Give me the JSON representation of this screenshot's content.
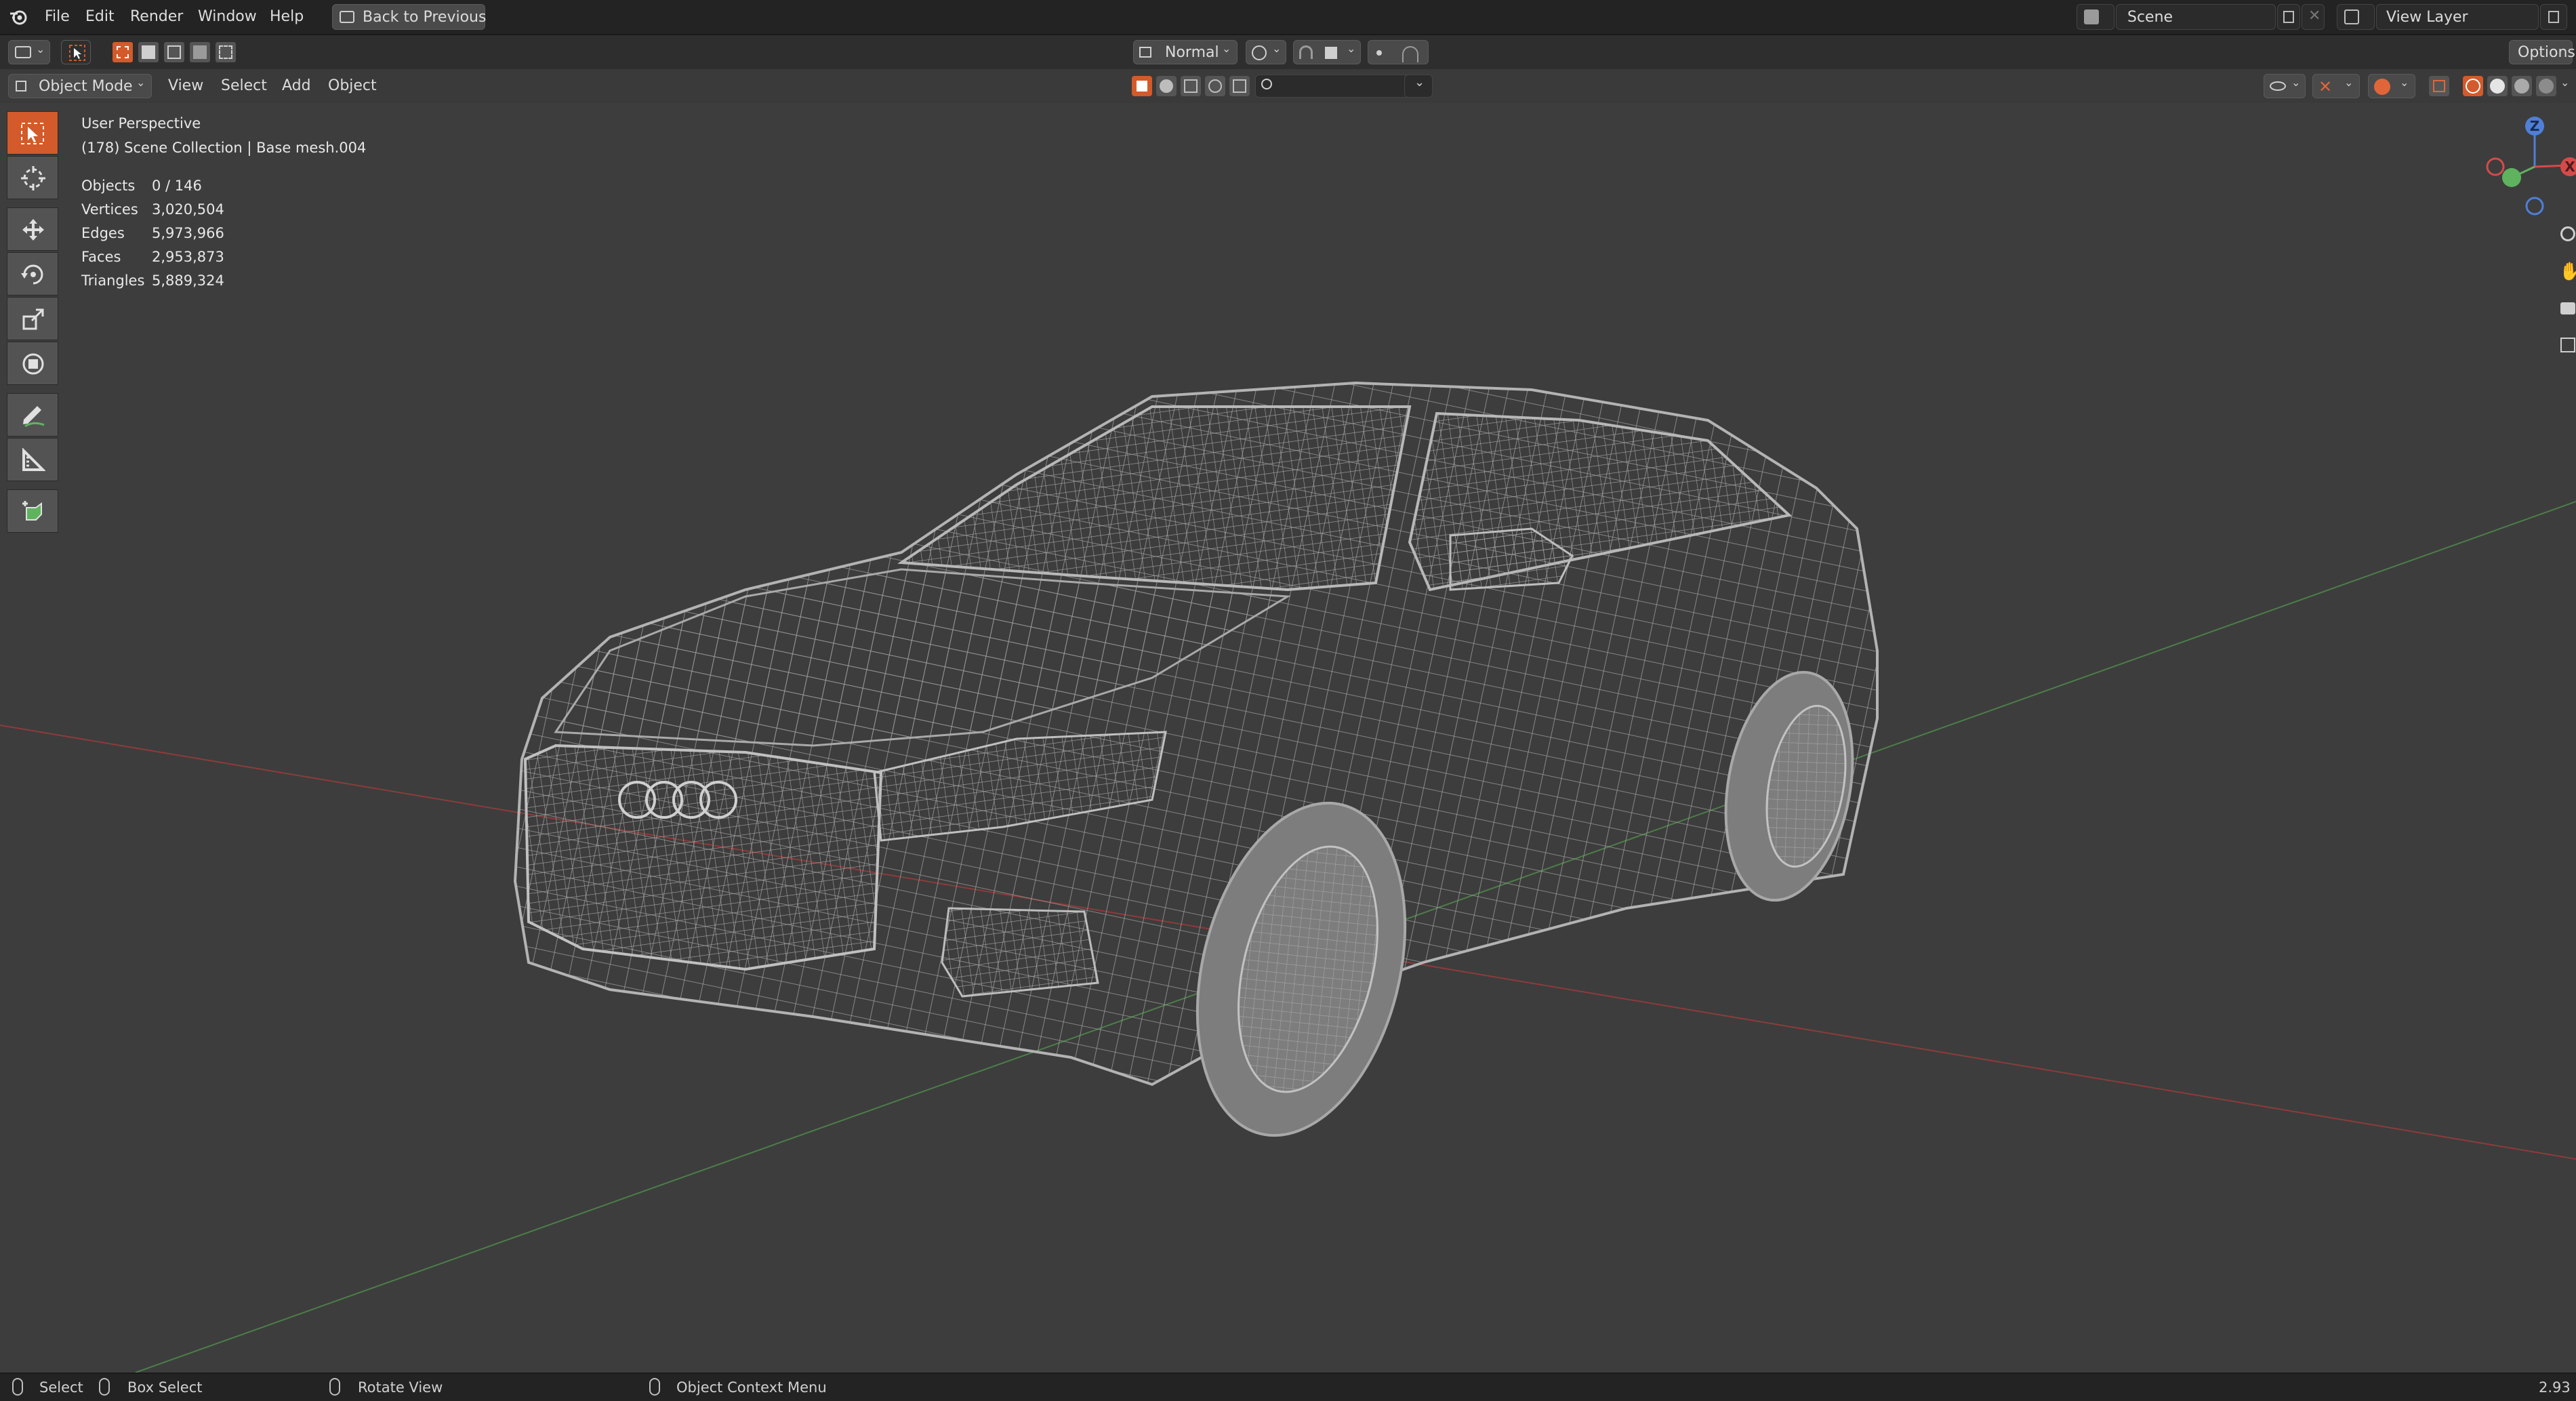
{
  "menubar": {
    "items": [
      "File",
      "Edit",
      "Render",
      "Window",
      "Help"
    ],
    "back_button": "Back to Previous",
    "scene_label": "Scene",
    "view_layer_label": "View Layer"
  },
  "toolheader": {
    "transform_orientation": "Normal",
    "options_label": "Options"
  },
  "viewheader": {
    "mode": "Object Mode",
    "menus": [
      "View",
      "Select",
      "Add",
      "Object"
    ]
  },
  "viewport": {
    "perspective": "User Perspective",
    "collection": "(178) Scene Collection | Base mesh.004",
    "stats": [
      {
        "label": "Objects",
        "value": "0 / 146"
      },
      {
        "label": "Vertices",
        "value": "3,020,504"
      },
      {
        "label": "Edges",
        "value": "5,973,966"
      },
      {
        "label": "Faces",
        "value": "2,953,873"
      },
      {
        "label": "Triangles",
        "value": "5,889,324"
      }
    ],
    "gizmo_axes": {
      "z": "Z",
      "x": "X"
    }
  },
  "statusbar": {
    "select": "Select",
    "box_select": "Box Select",
    "rotate_view": "Rotate View",
    "context_menu": "Object Context Menu",
    "version": "2.93"
  },
  "colors": {
    "accent": "#d35a2a",
    "background": "#3d3d3d",
    "x_axis": "#9b3b3b",
    "y_axis": "#4f8a4a"
  }
}
